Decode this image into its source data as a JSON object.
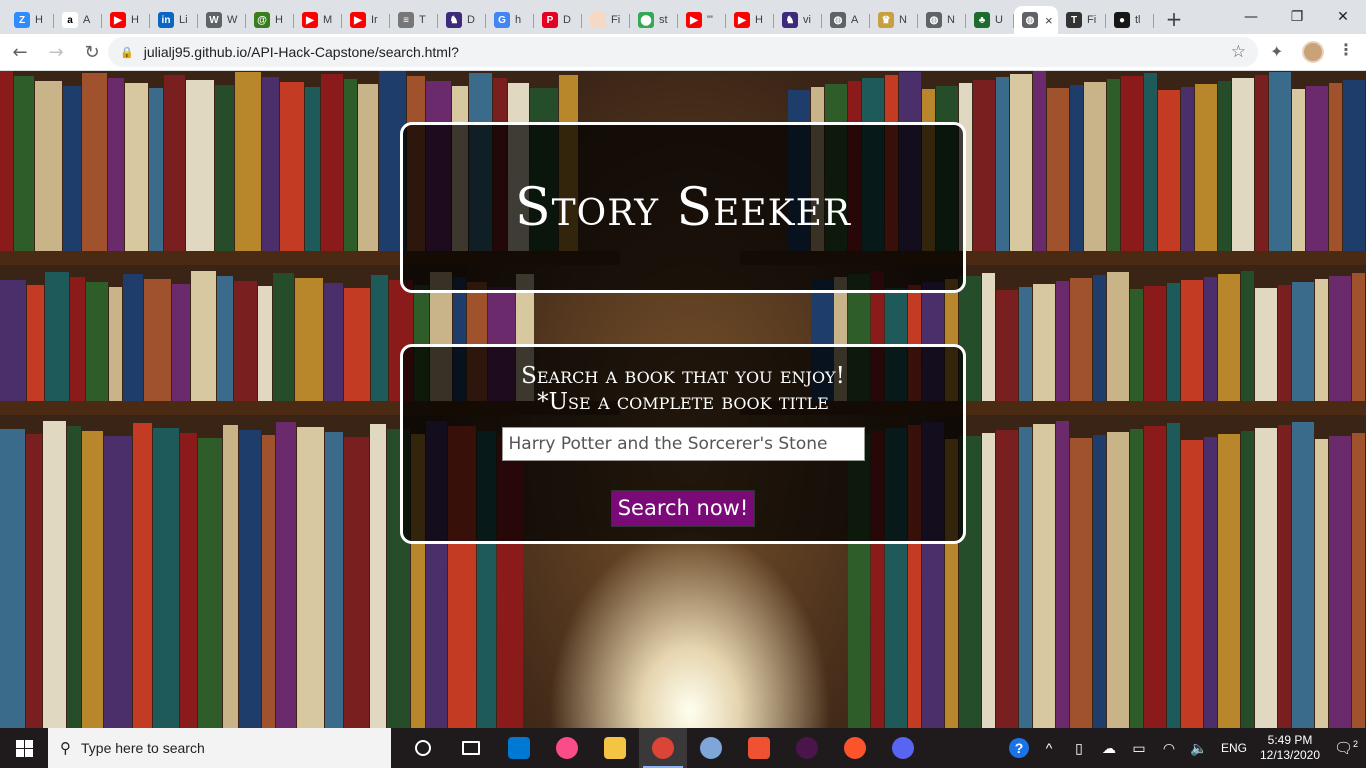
{
  "browser": {
    "tabs": [
      {
        "icon": "zoom-icon",
        "label": "H",
        "color": "#2d8cff",
        "glyph": "Z"
      },
      {
        "icon": "amazon-icon",
        "label": "A",
        "color": "#ffffff",
        "glyph": "a"
      },
      {
        "icon": "youtube-icon",
        "label": "H",
        "color": "#ff0000",
        "glyph": "▶"
      },
      {
        "icon": "linkedin-icon",
        "label": "Li",
        "color": "#0a66c2",
        "glyph": "in"
      },
      {
        "icon": "w-site-icon",
        "label": "W",
        "color": "#5f6368",
        "glyph": "W"
      },
      {
        "icon": "h-site-icon",
        "label": "H",
        "color": "#3a7d1c",
        "glyph": "@"
      },
      {
        "icon": "youtube-icon",
        "label": "M",
        "color": "#ff0000",
        "glyph": "▶"
      },
      {
        "icon": "youtube-icon",
        "label": "Ir",
        "color": "#ff0000",
        "glyph": "▶"
      },
      {
        "icon": "text-site-icon",
        "label": "T",
        "color": "#777777",
        "glyph": "≡"
      },
      {
        "icon": "feather-icon",
        "label": "D",
        "color": "#3d2a7a",
        "glyph": "♞"
      },
      {
        "icon": "google-icon",
        "label": "h",
        "color": "#4285f4",
        "glyph": "G"
      },
      {
        "icon": "pinterest-icon",
        "label": "D",
        "color": "#e60023",
        "glyph": "P"
      },
      {
        "icon": "blank-page-icon",
        "label": "Fi",
        "color": "#f5d9c4",
        "glyph": " "
      },
      {
        "icon": "maps-icon",
        "label": "st",
        "color": "#34a853",
        "glyph": "⬤"
      },
      {
        "icon": "youtube-icon",
        "label": "\"'",
        "color": "#ff0000",
        "glyph": "▶"
      },
      {
        "icon": "youtube-icon",
        "label": "H",
        "color": "#ff0000",
        "glyph": "▶"
      },
      {
        "icon": "feather-icon",
        "label": "vi",
        "color": "#3d2a7a",
        "glyph": "♞"
      },
      {
        "icon": "globe-icon",
        "label": "A",
        "color": "#5f6368",
        "glyph": "◍"
      },
      {
        "icon": "crest-icon",
        "label": "N",
        "color": "#c8a040",
        "glyph": "♛"
      },
      {
        "icon": "globe-icon",
        "label": "N",
        "color": "#5f6368",
        "glyph": "◍"
      },
      {
        "icon": "tree-icon",
        "label": "U",
        "color": "#1e6b2e",
        "glyph": "♣"
      },
      {
        "icon": "globe-icon",
        "label": "",
        "color": "#5f6368",
        "glyph": "◍",
        "active": true
      },
      {
        "icon": "tt-icon",
        "label": "Fi",
        "color": "#333333",
        "glyph": "T"
      },
      {
        "icon": "github-icon",
        "label": "tl",
        "color": "#181717",
        "glyph": "●"
      }
    ],
    "active_tab_close": "×",
    "new_tab": "+",
    "window_controls": {
      "minimize": "—",
      "maximize": "❐",
      "close": "✕"
    },
    "nav": {
      "back": "←",
      "forward": "→",
      "reload": "↻"
    },
    "url": "julialj95.github.io/API-Hack-Capstone/search.html?",
    "star": "☆",
    "extensions": "✦",
    "menu": "⋮"
  },
  "page": {
    "title": "Story Seeker",
    "search_line_1": "Search a book that you enjoy!",
    "search_line_2": "*Use a complete book title",
    "search_value": "Harry Potter and the Sorcerer's Stone",
    "search_button": "Search now!",
    "colors": {
      "button": "#7a0a78",
      "card_border": "#ffffff"
    }
  },
  "taskbar": {
    "search_placeholder": "Type here to search",
    "apps": [
      {
        "name": "cortana-icon",
        "color": "none"
      },
      {
        "name": "task-view-icon",
        "color": "none"
      },
      {
        "name": "vscode-icon",
        "color": "#0078d4"
      },
      {
        "name": "itunes-icon",
        "color": "#f94c88"
      },
      {
        "name": "file-explorer-icon",
        "color": "#f4c542"
      },
      {
        "name": "chrome-icon",
        "color": "#db4437",
        "active": true
      },
      {
        "name": "weather-icon",
        "color": "#7ea6d8"
      },
      {
        "name": "git-icon",
        "color": "#f05133"
      },
      {
        "name": "slack-icon",
        "color": "#4a154b"
      },
      {
        "name": "brave-icon",
        "color": "#fb542b"
      },
      {
        "name": "discord-icon",
        "color": "#5865f2"
      }
    ],
    "tray": {
      "help": "?",
      "chevron": "^",
      "language": "ENG",
      "time": "5:49 PM",
      "date": "12/13/2020",
      "notifications": "2"
    }
  }
}
